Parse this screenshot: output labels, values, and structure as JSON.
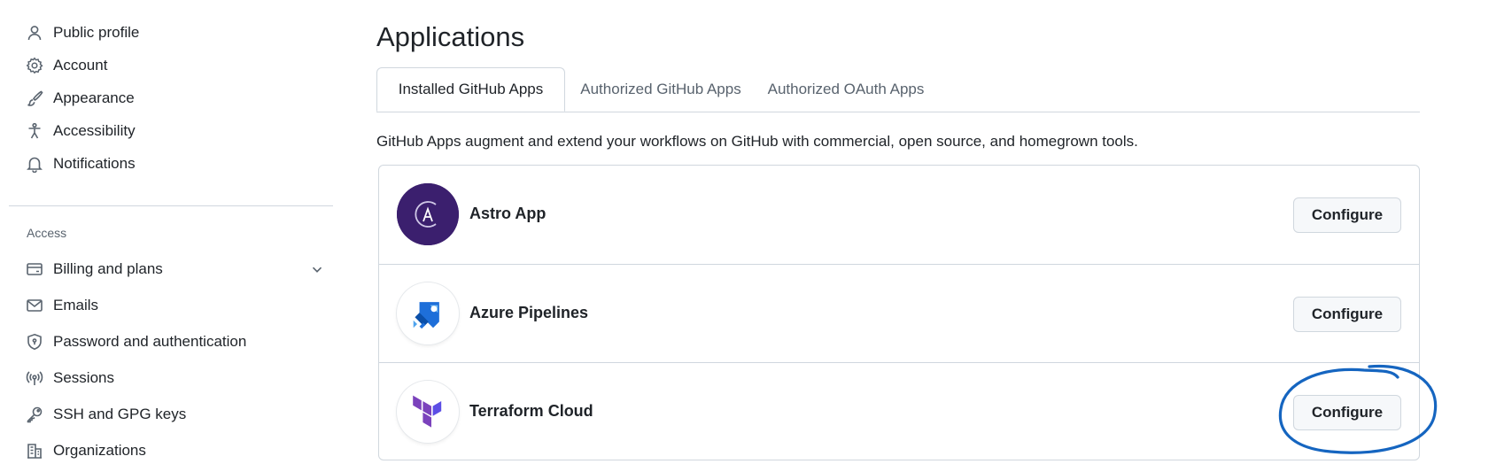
{
  "sidebar": {
    "items": [
      {
        "label": "Public profile",
        "icon": "person-icon"
      },
      {
        "label": "Account",
        "icon": "gear-icon"
      },
      {
        "label": "Appearance",
        "icon": "paintbrush-icon"
      },
      {
        "label": "Accessibility",
        "icon": "accessibility-icon"
      },
      {
        "label": "Notifications",
        "icon": "bell-icon"
      }
    ],
    "access_label": "Access",
    "access_items": [
      {
        "label": "Billing and plans",
        "icon": "credit-card-icon"
      },
      {
        "label": "Emails",
        "icon": "mail-icon"
      },
      {
        "label": "Password and authentication",
        "icon": "shield-lock-icon"
      },
      {
        "label": "Sessions",
        "icon": "broadcast-icon"
      },
      {
        "label": "SSH and GPG keys",
        "icon": "key-icon"
      },
      {
        "label": "Organizations",
        "icon": "organization-icon"
      }
    ]
  },
  "main": {
    "title": "Applications",
    "tabs": [
      {
        "label": "Installed GitHub Apps",
        "active": true
      },
      {
        "label": "Authorized GitHub Apps",
        "active": false
      },
      {
        "label": "Authorized OAuth Apps",
        "active": false
      }
    ],
    "description": "GitHub Apps augment and extend your workflows on GitHub with commercial, open source, and homegrown tools.",
    "apps": [
      {
        "name": "Astro App",
        "button": "Configure",
        "icon": "astro-logo-icon"
      },
      {
        "name": "Azure Pipelines",
        "button": "Configure",
        "icon": "azure-pipelines-logo-icon"
      },
      {
        "name": "Terraform Cloud",
        "button": "Configure",
        "icon": "terraform-logo-icon"
      }
    ]
  },
  "colors": {
    "annotation": "#1565c0",
    "astro_bg": "#3b1f6e",
    "terraform": "#7b42bc",
    "azure": "#1e6fd9"
  }
}
